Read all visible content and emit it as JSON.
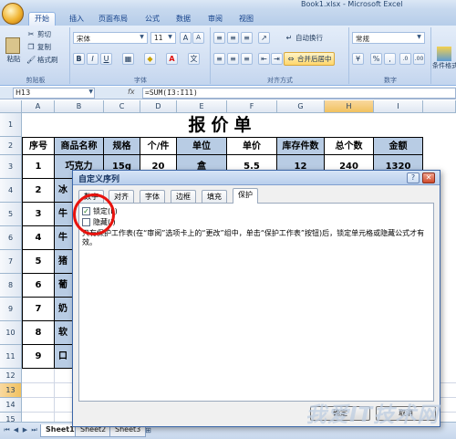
{
  "window": {
    "title": "Book1.xlsx - Microsoft Excel"
  },
  "ribbon_tabs": [
    "开始",
    "插入",
    "页面布局",
    "公式",
    "数据",
    "审阅",
    "视图"
  ],
  "ribbon": {
    "clipboard": {
      "paste": "粘贴",
      "cut": "剪切",
      "copy": "复制",
      "format_painter": "格式刷",
      "label": "剪贴板"
    },
    "font": {
      "family": "宋体",
      "size": "11",
      "label": "字体"
    },
    "alignment": {
      "wrap": "自动换行",
      "merge": "合并后居中",
      "label": "对齐方式"
    },
    "number": {
      "format": "常规",
      "label": "数字"
    },
    "styles": {
      "cond": "条件格式"
    }
  },
  "formula_bar": {
    "name_box": "H13",
    "fx": "fx",
    "formula": "=SUM(I3:I11)"
  },
  "columns": [
    "A",
    "B",
    "C",
    "D",
    "E",
    "F",
    "G",
    "H",
    "I"
  ],
  "rows": [
    "1",
    "2",
    "3",
    "4",
    "5",
    "6",
    "7",
    "8",
    "9",
    "10",
    "11",
    "12",
    "13",
    "14",
    "15"
  ],
  "sheet": {
    "title": "报价单",
    "headers": [
      "序号",
      "商品名称",
      "规格",
      "个/件",
      "单位",
      "单价",
      "库存件数",
      "总个数",
      "金额"
    ],
    "row3": [
      "1",
      "巧克力",
      "15g",
      "20",
      "盒",
      "5.5",
      "12",
      "240",
      "1320"
    ],
    "row_labels": [
      "2",
      "3",
      "4",
      "5",
      "6",
      "7",
      "8",
      "9"
    ],
    "row_names": [
      "冰",
      "牛",
      "牛",
      "猪",
      "葡",
      "奶",
      "软",
      "口"
    ]
  },
  "sheet_tabs": [
    "Sheet1",
    "Sheet2",
    "Sheet3"
  ],
  "dialog": {
    "title": "自定义序列",
    "tabs": [
      "数字",
      "对齐",
      "字体",
      "边框",
      "填充",
      "保护"
    ],
    "locked_label": "锁定(L)",
    "locked_checked": true,
    "hidden_label": "隐藏(I)",
    "hidden_checked": false,
    "description": "只有保护工作表(在“审阅”选项卡上的“更改”组中，单击“保护工作表”按钮)后，锁定单元格或隐藏公式才有效。",
    "ok": "确定",
    "cancel": "取消"
  },
  "watermark": "我爱IT技术网"
}
